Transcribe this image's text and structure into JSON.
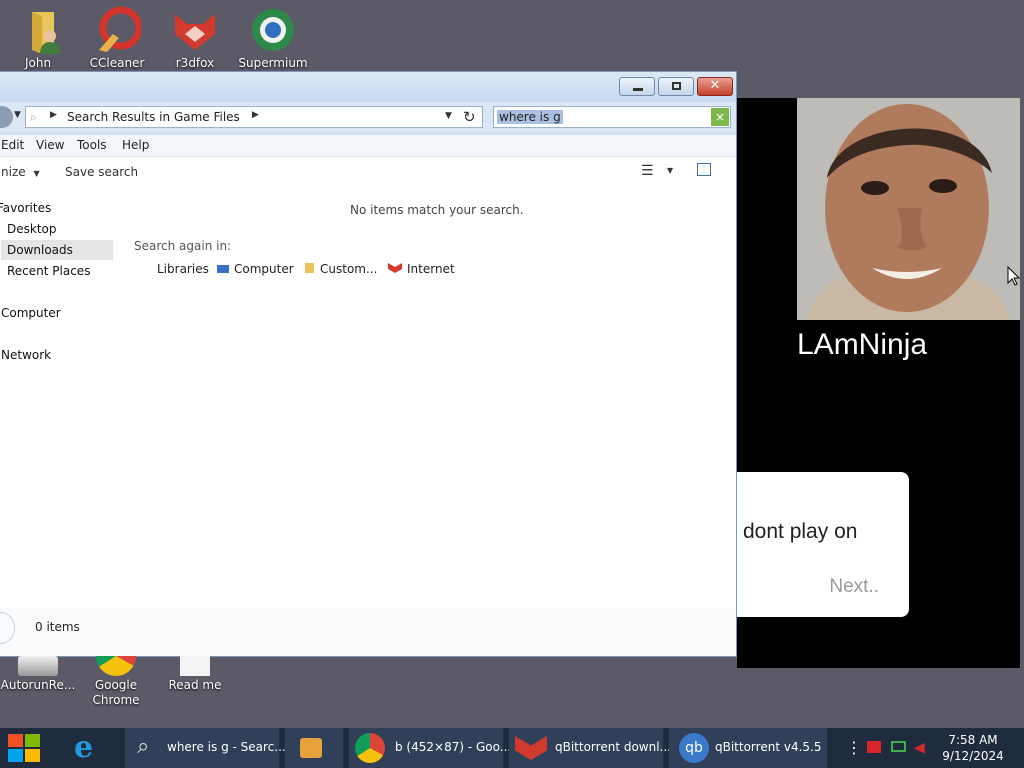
{
  "desktop": {
    "icons_top": [
      {
        "label": "John"
      },
      {
        "label": "CCleaner"
      },
      {
        "label": "r3dfox"
      },
      {
        "label": "Supermium"
      }
    ],
    "icons_bottom": [
      {
        "label": "AutorunRe..."
      },
      {
        "label": "Google Chrome"
      },
      {
        "label": "Read me"
      }
    ]
  },
  "video": {
    "name": "LAmNinja",
    "dialog_text": "dont play on",
    "dialog_next": "Next.."
  },
  "explorer": {
    "breadcrumb": "Search Results in Game Files",
    "search_value": "where is g",
    "menu": [
      "Edit",
      "View",
      "Tools",
      "Help"
    ],
    "cmd": {
      "organize": "nize",
      "save_search": "Save search"
    },
    "nav": {
      "favorites": "Favorites",
      "desktop": "Desktop",
      "downloads": "Downloads",
      "recent": "Recent Places",
      "computer": "Computer",
      "network": "Network"
    },
    "empty_message": "No items match your search.",
    "search_again": "Search again in:",
    "search_targets": [
      "Libraries",
      "Computer",
      "Custom...",
      "Internet"
    ],
    "status_count": "0 items"
  },
  "taskbar": {
    "items": [
      {
        "label": "where is g - Searc..."
      },
      {
        "label": "b (452×87) - Goo..."
      },
      {
        "label": "qBittorrent downl..."
      },
      {
        "label": "qBittorrent v4.5.5"
      }
    ],
    "time": "7:58 AM",
    "date": "9/12/2024"
  },
  "colors": {
    "accent": "#7fb84a",
    "close": "#c4412b",
    "taskbar": "#1f2c3d"
  }
}
